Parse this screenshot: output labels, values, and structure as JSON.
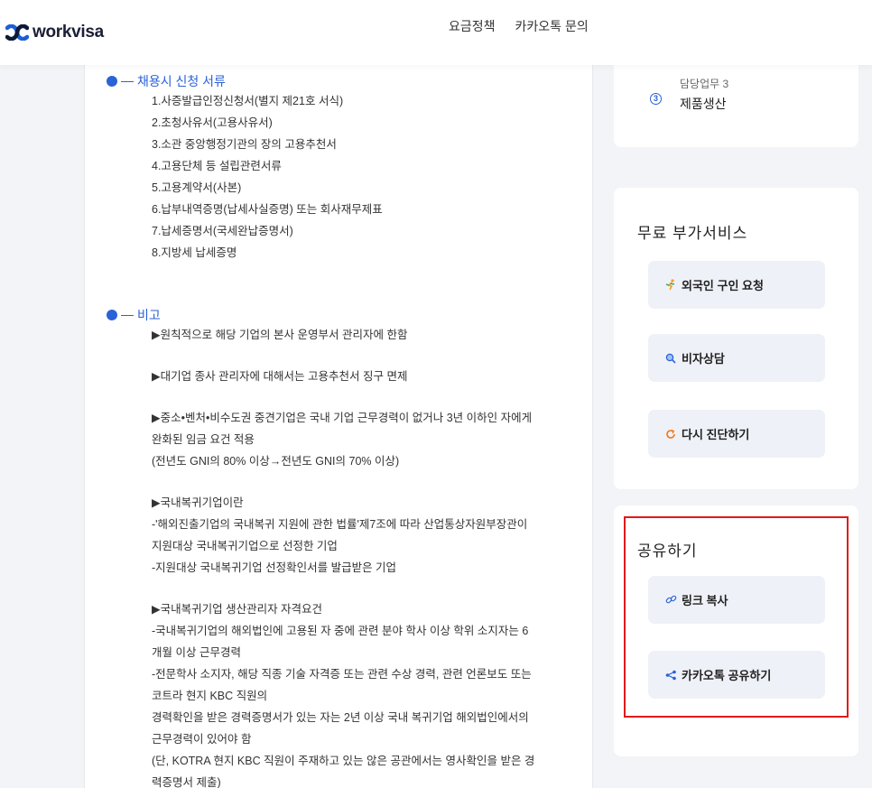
{
  "header": {
    "logo_text": "workvisa",
    "nav": [
      "요금정책",
      "카카오톡 문의"
    ]
  },
  "documents": {
    "title": "채용시 신청 서류",
    "items": [
      "1.사증발급인정신청서(별지 제21호 서식)",
      "2.초청사유서(고용사유서)",
      "3.소관 중앙행정기관의 장의 고용추천서",
      "4.고용단체 등 설립관련서류",
      "5.고용계약서(사본)",
      "6.납부내역증명(납세사실증명) 또는 회사재무제표",
      "7.납세증명서(국세완납증명서)",
      "8.지방세 납세증명"
    ]
  },
  "remarks": {
    "title": "비고",
    "lines": [
      "▶원칙적으로 해당 기업의 본사 운영부서 관리자에 한함",
      "",
      "▶대기업 종사 관리자에 대해서는 고용추천서 징구 면제",
      "",
      "▶중소•벤처•비수도권 중견기업은 국내 기업 근무경력이 없거나 3년 이하인 자에게",
      "완화된 임금 요건 적용",
      "(전년도 GNI의 80% 이상→전년도 GNI의 70% 이상)",
      "",
      "▶국내복귀기업이란",
      "-'해외진출기업의 국내복귀 지원에 관한 법률'제7조에 따라 산업통상자원부장관이",
      "지원대상 국내복귀기업으로 선정한 기업",
      "-지원대상 국내복귀기업 선정확인서를 발급받은 기업",
      "",
      "▶국내복귀기업 생산관리자 자격요건",
      "-국내복귀기업의 해외법인에 고용된 자 중에 관련 분야 학사 이상 학위 소지자는 6",
      "개월 이상 근무경력",
      "-전문학사 소지자, 해당 직종 기술 자격증 또는 관련 수상 경력, 관련 언론보도 또는",
      "코트라 현지 KBC 직원의",
      "경력확인을 받은 경력증명서가 있는 자는 2년 이상 국내 복귀기업 해외법인에서의",
      "근무경력이 있어야 함",
      "(단, KOTRA 현지 KBC 직원이 주재하고 있는 않은 공관에서는 영사확인을 받은 경",
      "력증명서 제출)"
    ]
  },
  "duty": {
    "label": "담당업무 3",
    "number": "3",
    "value": "제품생산"
  },
  "services": {
    "title": "무료 부가서비스",
    "buttons": [
      {
        "label": "외국인 구인 요청",
        "icon": "running-person-icon"
      },
      {
        "label": "비자상담",
        "icon": "search-icon"
      },
      {
        "label": "다시 진단하기",
        "icon": "refresh-icon"
      }
    ]
  },
  "share": {
    "title": "공유하기",
    "buttons": [
      {
        "label": "링크 복사",
        "icon": "link-icon"
      },
      {
        "label": "카카오톡 공유하기",
        "icon": "share-icon"
      }
    ]
  },
  "colors": {
    "accent": "#2a62d8",
    "highlight": "#e11a1a",
    "button_bg": "#eef1f7"
  }
}
